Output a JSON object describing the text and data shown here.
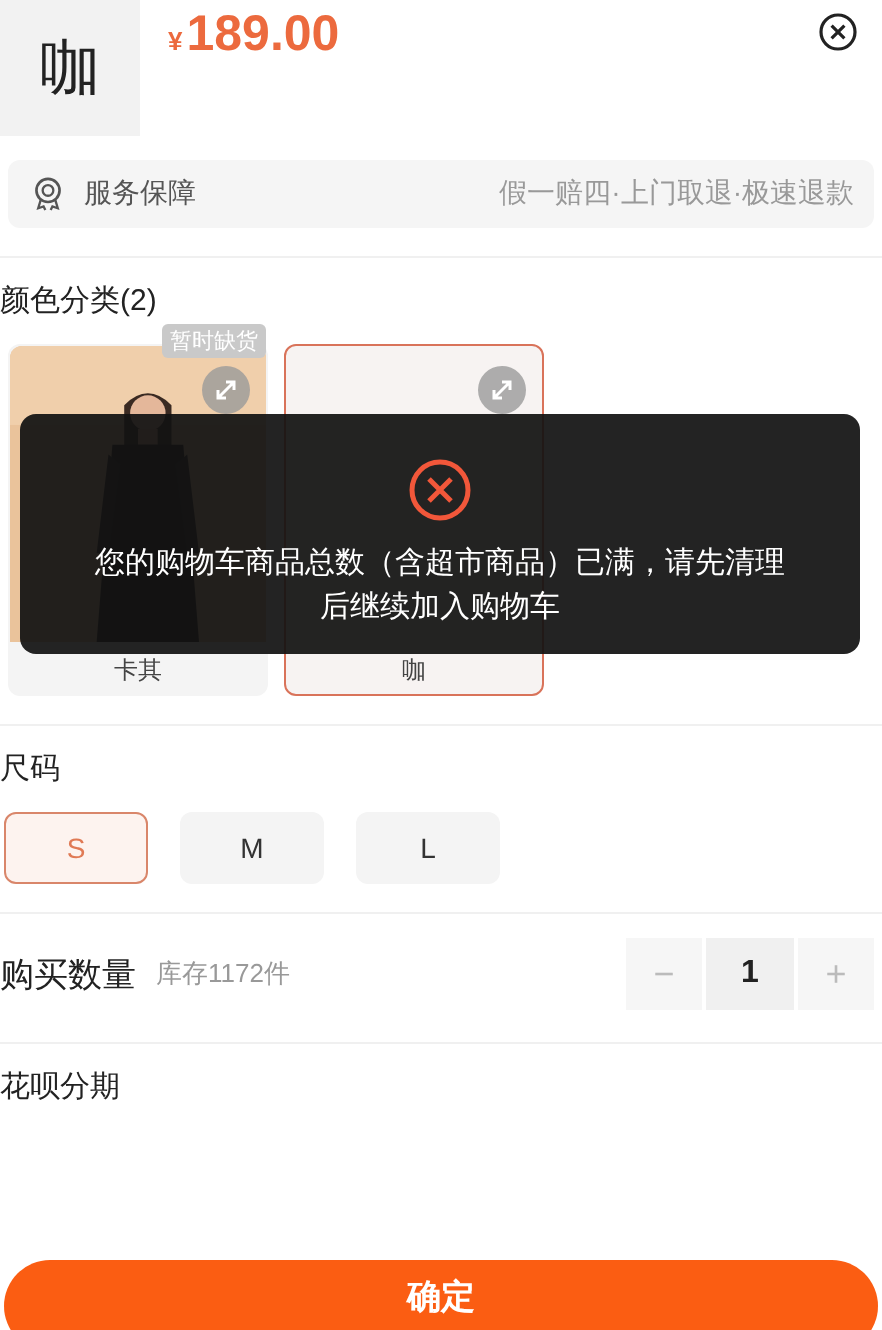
{
  "product": {
    "thumbnail_text": "咖",
    "currency": "¥",
    "price": "189.00"
  },
  "service": {
    "label": "服务保障",
    "details": "假一赔四·上门取退·极速退款"
  },
  "color_section": {
    "title": "颜色分类(2)",
    "options": [
      {
        "kind": "picture",
        "label": "卡其",
        "badge": "暂时缺货",
        "selected": false
      },
      {
        "kind": "text",
        "label": "咖",
        "selected": true
      }
    ]
  },
  "size_section": {
    "title": "尺码",
    "options": [
      {
        "label": "S",
        "selected": true
      },
      {
        "label": "M",
        "selected": false
      },
      {
        "label": "L",
        "selected": false
      }
    ]
  },
  "quantity": {
    "title": "购买数量",
    "stock": "库存1172件",
    "decrement": "−",
    "value": "1",
    "increment": "+"
  },
  "installment": {
    "title": "花呗分期"
  },
  "confirm_button": "确定",
  "toast": {
    "message": "您的购物车商品总数（含超市商品）已满，请先清理后继续加入购物车"
  }
}
